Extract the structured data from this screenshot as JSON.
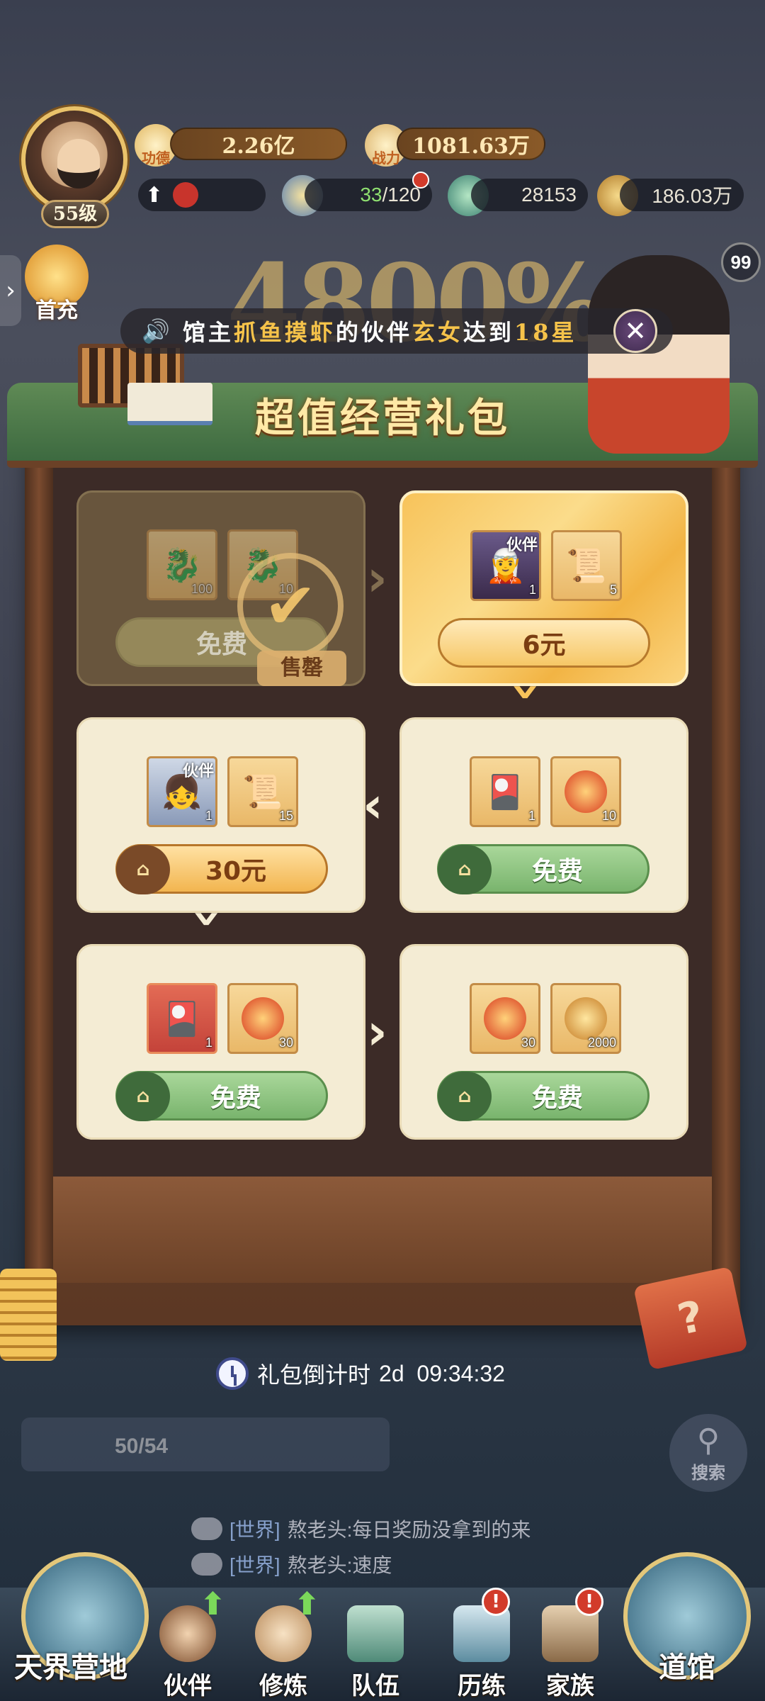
{
  "player": {
    "level": "55级",
    "merit_label": "功德",
    "merit_value": "2.26亿",
    "power_label": "战力",
    "power_value": "1081.63万"
  },
  "resources": {
    "stamina": "33",
    "stamina_max": "/120",
    "fish": "28153",
    "coins": "186.03万"
  },
  "side": {
    "first_charge": "首充",
    "badge_count": "99"
  },
  "banner": {
    "number": "4800%"
  },
  "announcement": {
    "prefix": "馆主",
    "player": "抓鱼摸虾",
    "middle": "的伙伴",
    "partner": "玄女",
    "suffix": "达到",
    "stars": "18星"
  },
  "shop": {
    "title": "超值经营礼包",
    "sold_label": "售罄",
    "cards": [
      {
        "id": "card-1",
        "state": "sold",
        "items": [
          {
            "icon": "dragon-icon",
            "qty": "100"
          },
          {
            "icon": "dragon-icon",
            "qty": "10"
          }
        ],
        "button": "免费"
      },
      {
        "id": "card-2",
        "state": "featured",
        "items": [
          {
            "icon": "partner-portrait-icon",
            "qty": "1",
            "tag": "伙伴"
          },
          {
            "icon": "scroll-icon",
            "qty": "5"
          }
        ],
        "button": "6元"
      },
      {
        "id": "card-3",
        "items": [
          {
            "icon": "partner-portrait-icon",
            "qty": "1",
            "tag": "伙伴"
          },
          {
            "icon": "scroll-icon",
            "qty": "15"
          }
        ],
        "button": "30元"
      },
      {
        "id": "card-4",
        "items": [
          {
            "icon": "portrait-card-icon",
            "qty": "1"
          },
          {
            "icon": "luck-orb-icon",
            "qty": "10"
          }
        ],
        "button": "免费"
      },
      {
        "id": "card-5",
        "items": [
          {
            "icon": "portrait-card-icon",
            "qty": "1"
          },
          {
            "icon": "luck-orb-icon",
            "qty": "30"
          }
        ],
        "button": "免费"
      },
      {
        "id": "card-6",
        "items": [
          {
            "icon": "luck-orb-icon",
            "qty": "30"
          },
          {
            "icon": "gold-orb-icon",
            "qty": "2000"
          }
        ],
        "button": "免费"
      }
    ],
    "timer_label": "礼包倒计时",
    "timer_value": "2d  09:34:32"
  },
  "behind": {
    "progress": "50/54",
    "search_label": "搜索"
  },
  "chat": [
    {
      "channel": "[世界]",
      "text": "熬老头:每日奖励没拿到的来"
    },
    {
      "channel": "[世界]",
      "text": "熬老头:速度"
    }
  ],
  "nav": {
    "camp": "天界营地",
    "partner": "伙伴",
    "train": "修炼",
    "team": "队伍",
    "trial": "历练",
    "family": "家族",
    "hall": "道馆",
    "alert": "!"
  },
  "colors": {
    "accent_gold": "#f6c34a",
    "free_green": "#79b46d",
    "card_bg": "#f4ecd4"
  }
}
